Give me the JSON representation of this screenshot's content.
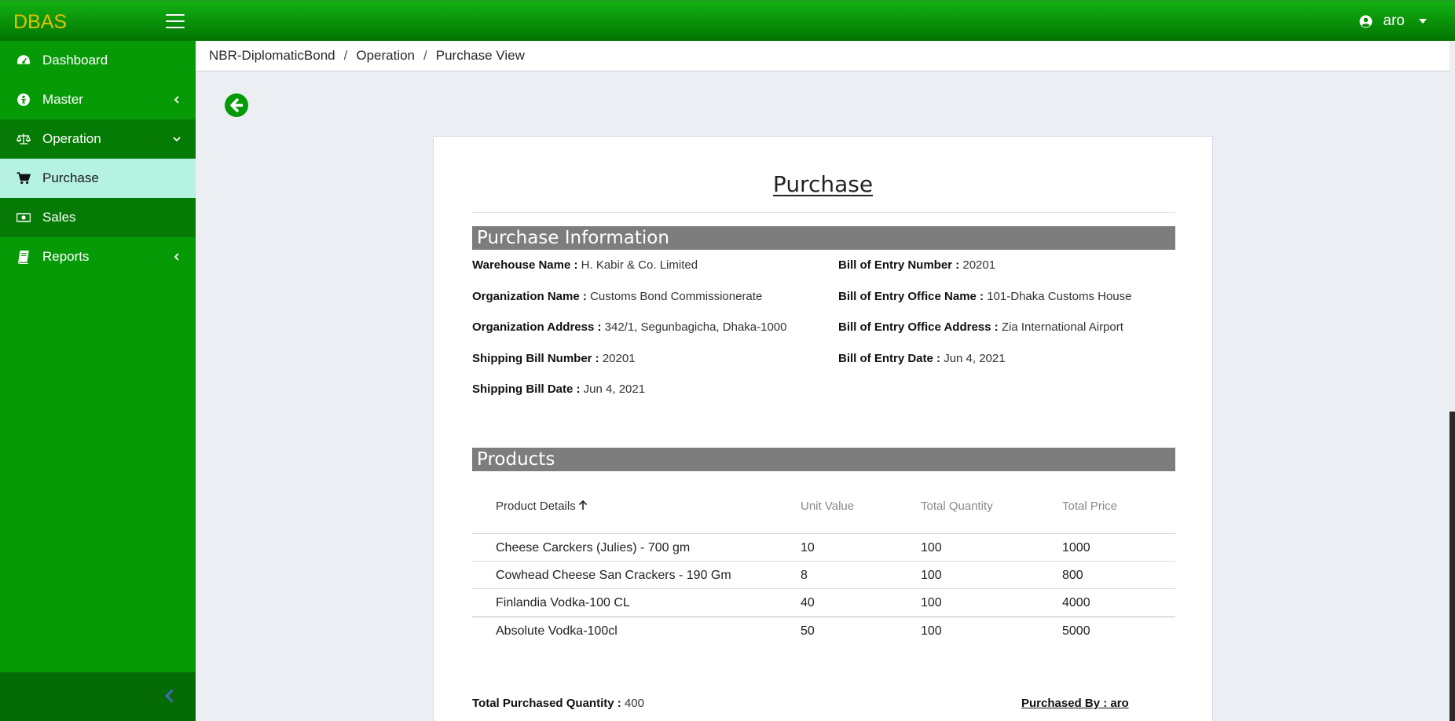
{
  "app": {
    "brand": "DBAS",
    "user": "aro"
  },
  "sidebar": {
    "items": [
      {
        "label": "Dashboard",
        "icon": "dashboard-icon"
      },
      {
        "label": "Master",
        "icon": "master-icon"
      },
      {
        "label": "Operation",
        "icon": "balance-scale-icon"
      },
      {
        "label": "Purchase",
        "icon": "cart-icon"
      },
      {
        "label": "Sales",
        "icon": "money-icon"
      },
      {
        "label": "Reports",
        "icon": "book-icon"
      }
    ]
  },
  "breadcrumb": [
    "NBR-DiplomaticBond",
    "Operation",
    "Purchase View"
  ],
  "page": {
    "title": "Purchase",
    "info_section": "Purchase Information",
    "products_section": "Products",
    "fields": {
      "warehouse_label": "Warehouse Name :",
      "warehouse_value": "H. Kabir & Co. Limited",
      "org_name_label": "Organization Name :",
      "org_name_value": "Customs Bond Commissionerate",
      "org_addr_label": "Organization Address :",
      "org_addr_value": "342/1, Segunbagicha, Dhaka-1000",
      "ship_num_label": "Shipping Bill Number :",
      "ship_num_value": "20201",
      "ship_date_label": "Shipping Bill Date :",
      "ship_date_value": "Jun 4, 2021",
      "boe_num_label": "Bill of Entry Number :",
      "boe_num_value": "20201",
      "boe_office_label": "Bill of Entry Office Name :",
      "boe_office_value": "101-Dhaka Customs House",
      "boe_addr_label": "Bill of Entry Office Address :",
      "boe_addr_value": "Zia International Airport",
      "boe_date_label": "Bill of Entry Date :",
      "boe_date_value": "Jun 4, 2021"
    },
    "table": {
      "headers": [
        "Product Details",
        "Unit Value",
        "Total Quantity",
        "Total Price"
      ],
      "rows": [
        [
          "Cheese Carckers (Julies) - 700 gm",
          "10",
          "100",
          "1000"
        ],
        [
          "Cowhead Cheese San Crackers - 190 Gm",
          "8",
          "100",
          "800"
        ],
        [
          "Finlandia Vodka-100 CL",
          "40",
          "100",
          "4000"
        ],
        [
          "Absolute Vodka-100cl",
          "50",
          "100",
          "5000"
        ]
      ]
    },
    "footer": {
      "total_qty_label": "Total Purchased Quantity :",
      "total_qty_value": "400",
      "purchased_by": "Purchased By : aro"
    }
  }
}
